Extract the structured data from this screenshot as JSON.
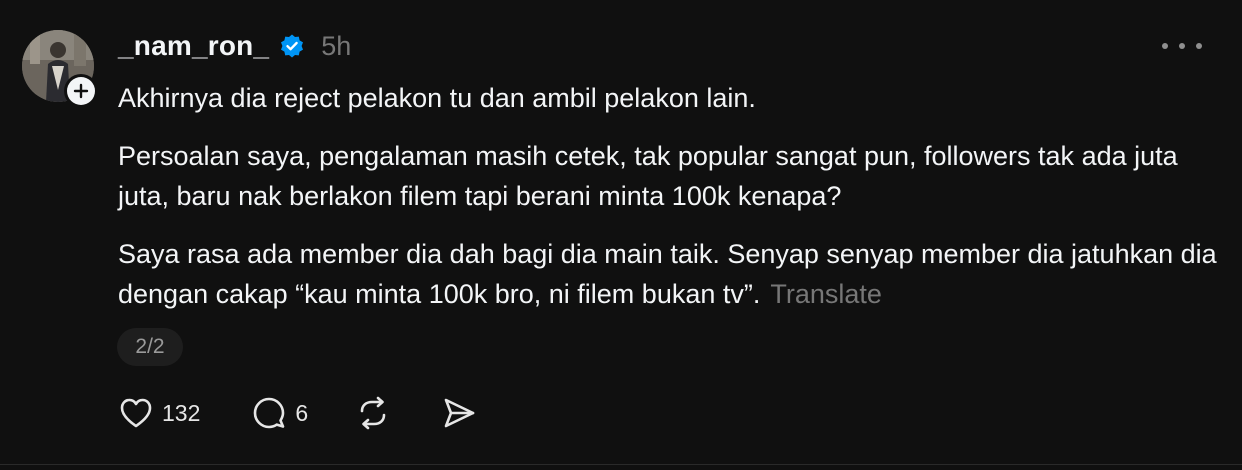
{
  "post": {
    "username": "_nam_ron_",
    "verified": true,
    "time": "5h",
    "paragraphs": [
      "Akhirnya dia reject pelakon tu dan ambil pelakon lain.",
      "Persoalan saya, pengalaman masih cetek, tak popular sangat pun, followers tak ada juta juta, baru nak berlakon filem tapi berani minta 100k kenapa?",
      "Saya rasa ada member dia dah bagi dia main taik. Senyap senyap member dia jatuhkan dia dengan cakap “kau minta 100k bro, ni filem bukan tv”."
    ],
    "translate_label": "Translate",
    "page_indicator": "2/2",
    "likes": "132",
    "replies": "6"
  },
  "icons": {
    "more": "more-horizontal-icon",
    "verified": "verified-badge-icon",
    "follow": "plus-icon",
    "like": "heart-icon",
    "reply": "comment-icon",
    "repost": "repost-icon",
    "share": "send-icon"
  },
  "colors": {
    "background": "#101010",
    "text": "#f3f5f7",
    "muted": "#777777",
    "verified_blue": "#0095f6"
  }
}
